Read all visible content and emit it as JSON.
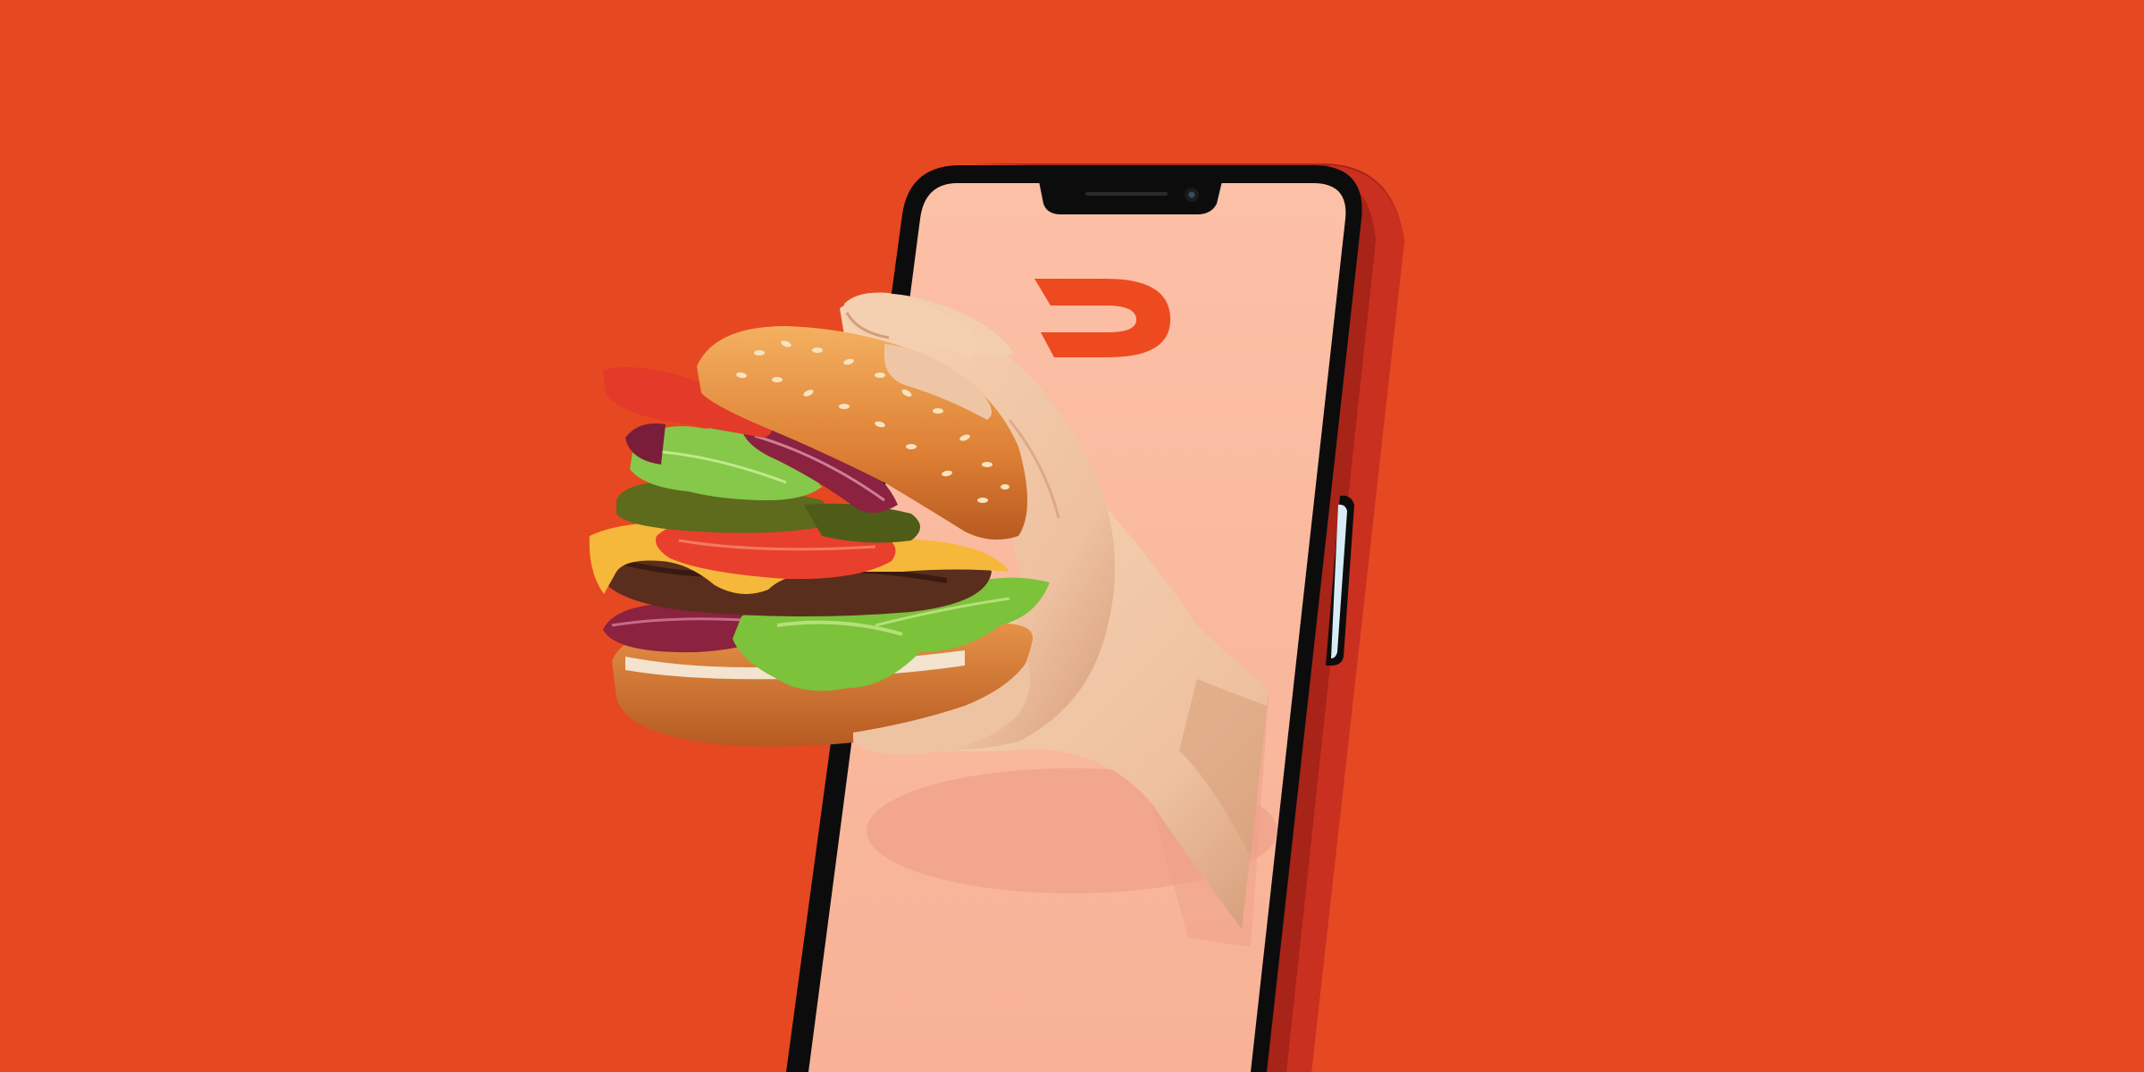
{
  "scene": {
    "description_free": true,
    "colors": {
      "background": "#e64822",
      "phone_body": "#b1271b",
      "phone_body_dark": "#7d160f",
      "phone_bezel": "#0c0c0c",
      "screen": "#fbb9a0",
      "screen_shadow": "#f0a68c",
      "logo": "#ee4a20",
      "button_highlight": "#d8ecf7",
      "skin": "#f0c9a6",
      "skin_shadow": "#d9a47e",
      "bun": "#e0843a",
      "bun_light": "#f2a45a",
      "patty": "#5a2e1d",
      "cheese": "#f6b83a",
      "tomato": "#e8402c",
      "lettuce": "#7cc23a",
      "onion": "#8a2240",
      "pickle": "#5e6a1c"
    },
    "icons": {
      "logo": "doordash-logo-icon",
      "camera": "front-camera-icon",
      "side_button": "side-button-icon"
    }
  }
}
